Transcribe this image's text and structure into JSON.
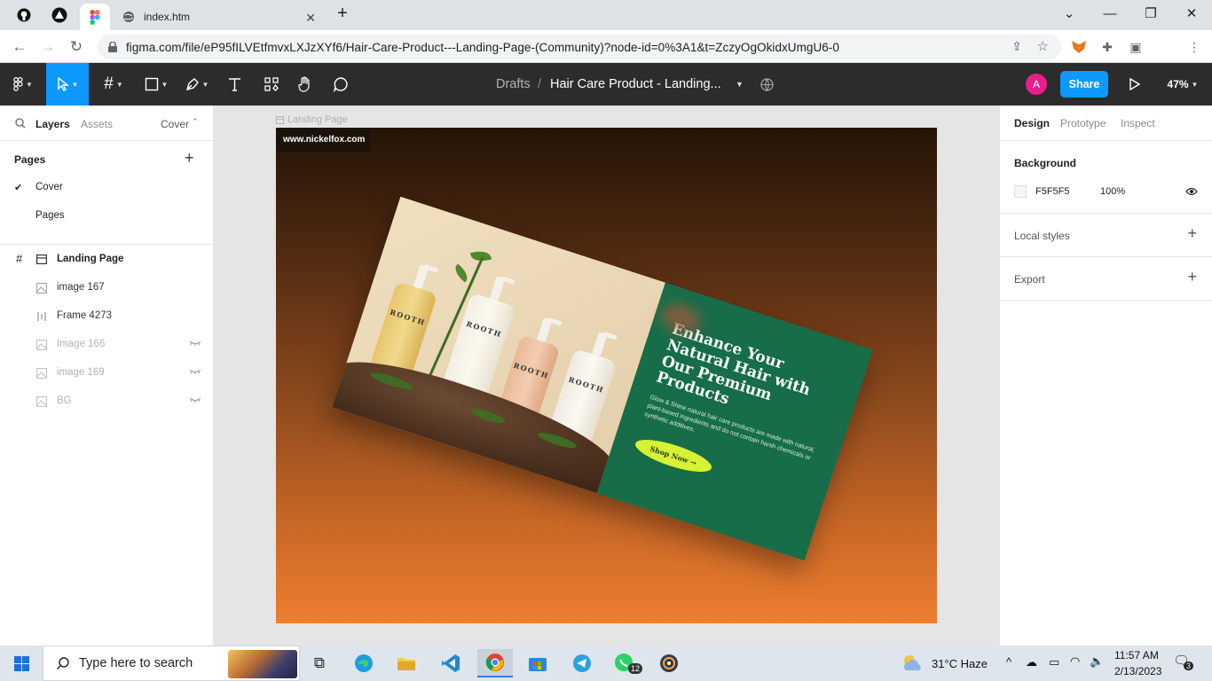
{
  "browser": {
    "tabs": [
      {
        "icon": "github-icon"
      },
      {
        "icon": "vercel-icon"
      },
      {
        "icon": "figma-icon",
        "active": true
      },
      {
        "icon": "globe-icon",
        "title": "index.htm"
      }
    ],
    "url": "figma.com/file/eP95fILVEtfmvxLXJzXYf6/Hair-Care-Product---Landing-Page-(Community)?node-id=0%3A1&t=ZczyOgOkidxUmgU6-0",
    "profile_initial": "A"
  },
  "figma": {
    "breadcrumb": {
      "root": "Drafts",
      "separator": "/",
      "file": "Hair Care Product - Landing..."
    },
    "share_label": "Share",
    "zoom": "47%",
    "user_initial": "A",
    "accent": "#0d99ff",
    "left_panel": {
      "tabs": {
        "layers": "Layers",
        "assets": "Assets",
        "page_switch": "Cover"
      },
      "pages_title": "Pages",
      "pages": [
        {
          "label": "Cover",
          "selected": true
        },
        {
          "label": "Pages",
          "selected": false
        }
      ],
      "frame": "Landing Page",
      "layers": [
        {
          "label": "image 167",
          "icon": "image-icon",
          "hidden": false
        },
        {
          "label": "Frame 4273",
          "icon": "frame-columns-icon",
          "hidden": false
        },
        {
          "label": "Image 166",
          "icon": "image-icon",
          "hidden": true
        },
        {
          "label": "image 169",
          "icon": "image-icon",
          "hidden": true
        },
        {
          "label": "BG",
          "icon": "image-icon",
          "hidden": true
        }
      ]
    },
    "canvas": {
      "frame_label": "Landing Page",
      "site_tag": "www.nickelfox.com",
      "banner": {
        "brand": "ROOTH",
        "title": "Enhance Your Natural Hair with Our Premium Products",
        "description": "Glow & Shine natural hair care products are made with natural, plant-based ingredients and do not contain harsh chemicals or synthetic additives.",
        "cta": "Shop Now →"
      }
    },
    "right_panel": {
      "tabs": {
        "design": "Design",
        "prototype": "Prototype",
        "inspect": "Inspect"
      },
      "background_title": "Background",
      "background_hex": "F5F5F5",
      "background_opacity": "100%",
      "local_styles": "Local styles",
      "export": "Export"
    },
    "help": "?"
  },
  "taskbar": {
    "search_placeholder": "Type here to search",
    "weather": "31°C  Haze",
    "time": "11:57 AM",
    "date": "2/13/2023",
    "whatsapp_badge": "12",
    "notification_count": "3"
  }
}
